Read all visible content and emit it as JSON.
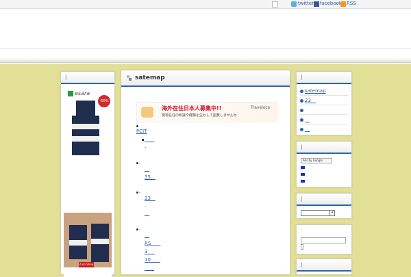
{
  "topbar": {
    "twitter": "twitter",
    "facebook": "facebook",
    "rss": "RSS",
    "icons": [
      "blank-box-icon",
      "twitter-icon",
      "facebook-icon",
      "rss-icon"
    ]
  },
  "left_panel": {
    "title": "|",
    "ad_brand": "esara",
    "ad_badge": "-50%",
    "ad_button": "Zum Shop"
  },
  "main": {
    "title": "satemap",
    "banner": {
      "headline": "海外在住日本人募集中!!",
      "subtext": "現地在住の知識や経験を生かして副業しませんか",
      "brand": "Traveloco"
    },
    "sections": [
      {
        "marker": "",
        "link": ""
      },
      {
        "marker": "",
        "link": "PCIT"
      },
      {
        "marker": "",
        "link": "____"
      },
      {
        "marker": ".",
        "link": ""
      },
      {
        "marker": ".",
        "link": ""
      },
      {
        "marker": "",
        "link": "__"
      },
      {
        "marker": "",
        "link": "35__"
      },
      {
        "marker": ".",
        "link": ""
      },
      {
        "marker": "",
        "link": "23__"
      },
      {
        "marker": ".",
        "link": ""
      },
      {
        "marker": "",
        "link": "__"
      },
      {
        "marker": ".",
        "link": ""
      },
      {
        "marker": "",
        "link": "__"
      },
      {
        "marker": "",
        "link": "RS____"
      },
      {
        "marker": "",
        "link": "3___"
      },
      {
        "marker": "",
        "link": "10____"
      },
      {
        "marker": "",
        "link": "____"
      }
    ]
  },
  "right_panels": {
    "r1": {
      "title": "|",
      "items": [
        "satemap",
        "23__",
        "",
        "__",
        "__"
      ]
    },
    "r2": {
      "title": "|",
      "ads_label": "Ads by Google"
    },
    "r3": {
      "title": "|"
    },
    "r4": {
      "title": ":"
    },
    "r5": {
      "title": "|"
    }
  }
}
